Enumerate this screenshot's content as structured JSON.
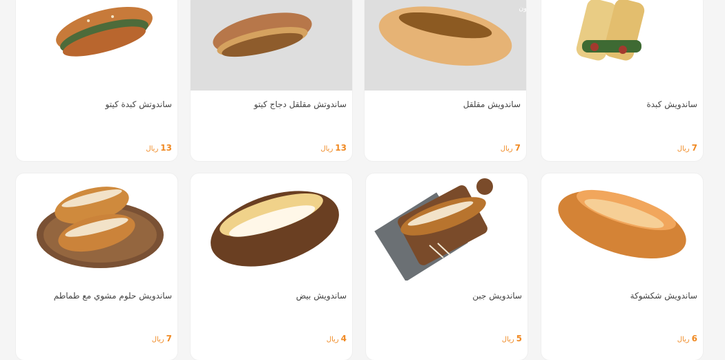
{
  "products": [
    {
      "title": "ساندوتش كبدة كيتو",
      "price": "13",
      "currency": "ريال"
    },
    {
      "title": "ساندوتش مقلقل دجاج كيتو",
      "price": "13",
      "currency": "ريال"
    },
    {
      "title": "ساندويش مقلقل",
      "price": "7",
      "currency": "ريال",
      "image_caption": "مع جبن أو بدون"
    },
    {
      "title": "ساندويش كبدة",
      "price": "7",
      "currency": "ريال"
    },
    {
      "title": "ساندويش حلوم مشوي مع طماطم",
      "price": "7",
      "currency": "ريال"
    },
    {
      "title": "ساندويش بيض",
      "price": "4",
      "currency": "ريال"
    },
    {
      "title": "ساندويش جبن",
      "price": "5",
      "currency": "ريال"
    },
    {
      "title": "ساندويش شكشوكة",
      "price": "6",
      "currency": "ريال"
    }
  ],
  "colors": {
    "price": "#f08a24",
    "card_bg": "#ffffff",
    "page_bg": "#f5f5f5"
  }
}
